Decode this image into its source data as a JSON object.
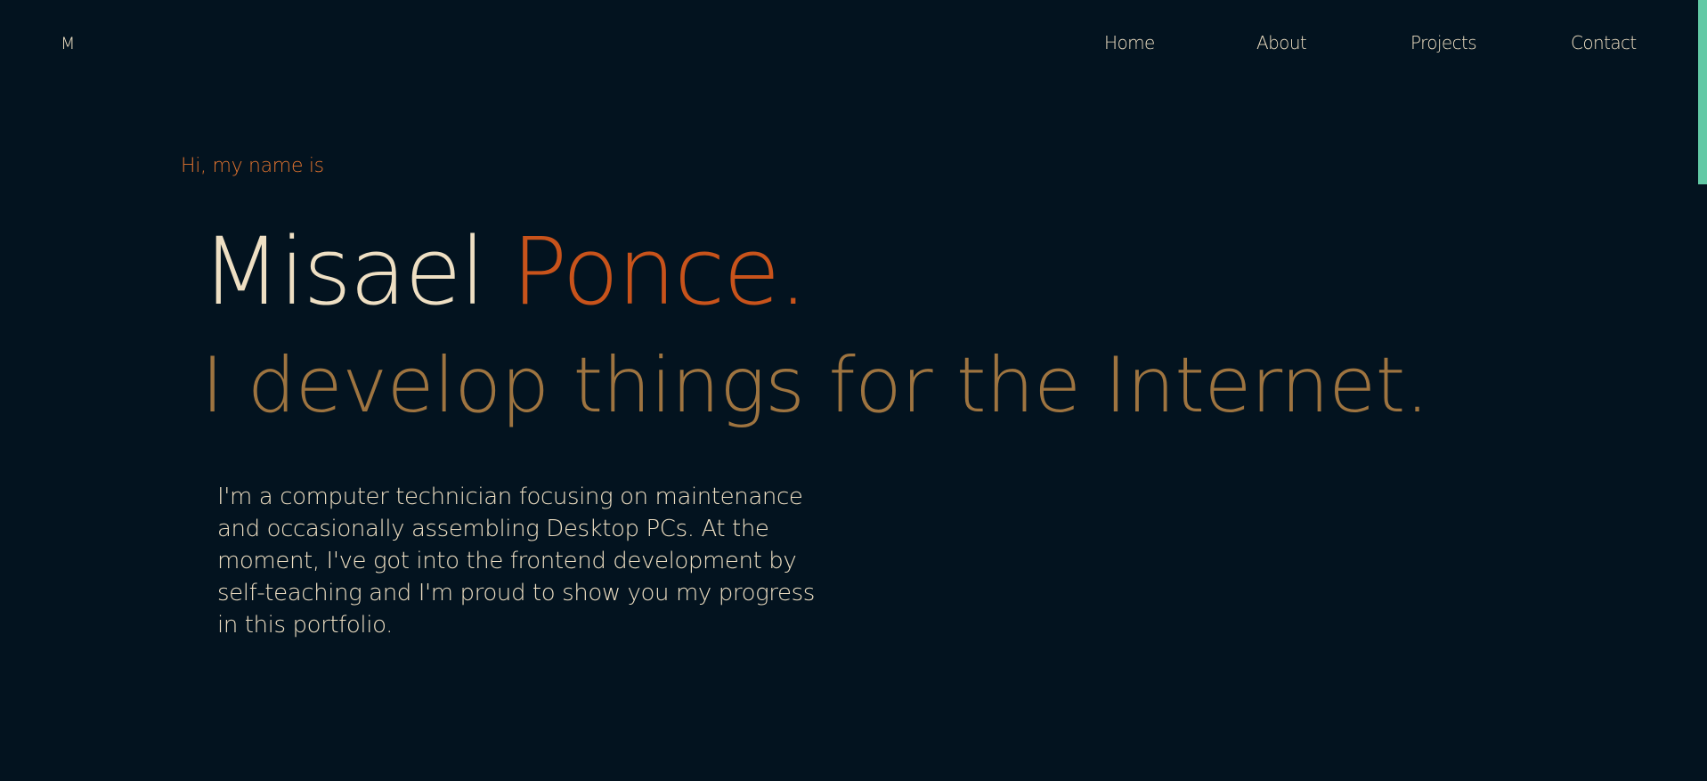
{
  "header": {
    "logo": "M",
    "nav": [
      {
        "label": "Home"
      },
      {
        "label": "About"
      },
      {
        "label": "Projects"
      },
      {
        "label": "Contact"
      }
    ]
  },
  "hero": {
    "greeting": "Hi, my name is",
    "first_name": "Misael",
    "last_name": "Ponce.",
    "tagline": "I develop things for the Internet.",
    "bio": "I'm a computer technician focusing on maintenance and occasionally assembling Desktop PCs. At the moment, I've got into the frontend development by self-teaching and I'm proud to show you my progress in this portfolio."
  },
  "colors": {
    "background": "#03131f",
    "text_primary": "#eedfc3",
    "accent_orange": "#c8531b",
    "greeting_orange": "#e0732f",
    "tagline_brown": "#9e7440",
    "scroll_indicator": "#62c9a5"
  }
}
